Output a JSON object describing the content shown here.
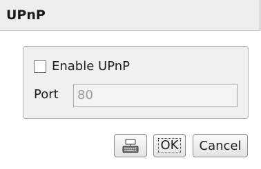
{
  "dialog": {
    "title": "UPnP",
    "enable_label": "Enable UPnP",
    "enable_checked": false,
    "port_label": "Port",
    "port_value": "80",
    "port_enabled": false
  },
  "buttons": {
    "keyboard_icon": "keyboard-icon",
    "ok_label": "OK",
    "cancel_label": "Cancel"
  },
  "colors": {
    "title_bg": "#eeeeee",
    "group_bg": "#f0f0f0",
    "disabled_text": "#9a9a9a"
  }
}
